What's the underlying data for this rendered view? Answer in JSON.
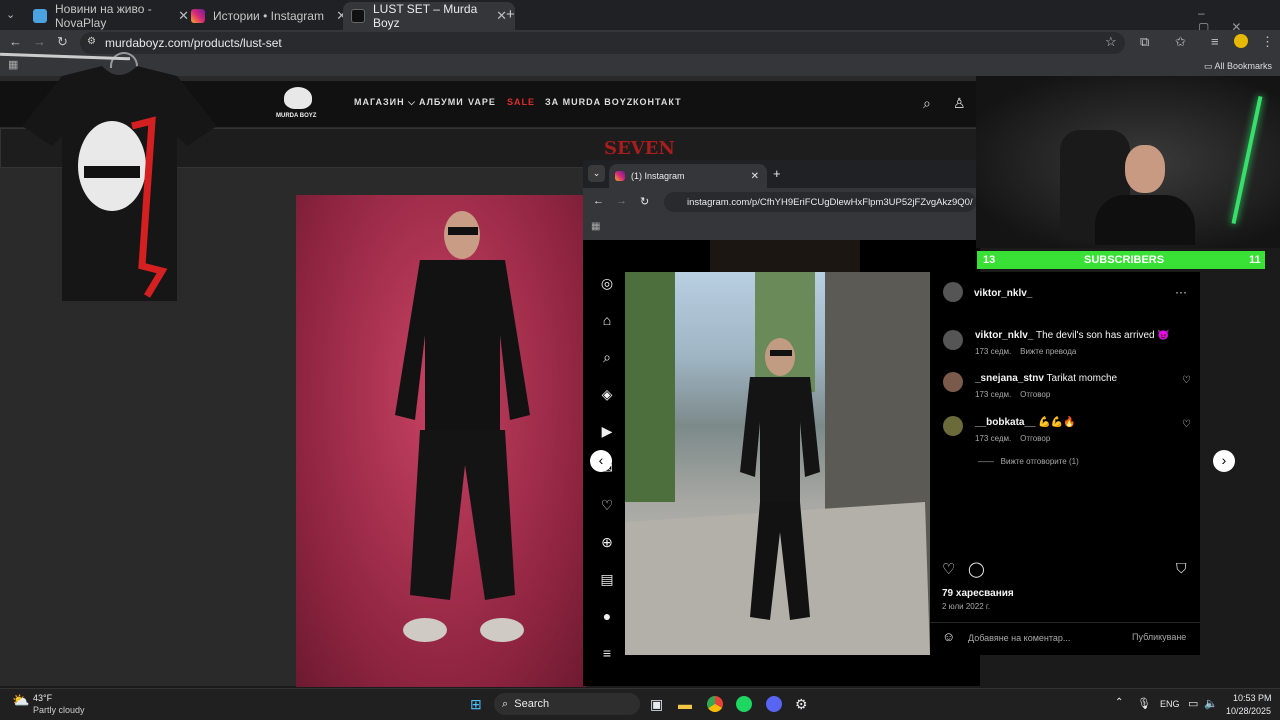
{
  "tabs": [
    {
      "label": "Новини на живо - NovaPlay",
      "color": "#4aa3df"
    },
    {
      "label": "Истории • Instagram",
      "color": "#d62976"
    },
    {
      "label": "LUST SET – Murda Boyz",
      "color": "#333333"
    }
  ],
  "url": "murdaboyz.com/products/lust-set",
  "bookmarks_label": "All Bookmarks",
  "site": {
    "logo": "MURDA BOYZ",
    "nav": [
      "МАГАЗИН",
      "АЛБУМИ",
      "VAPE",
      "SALE",
      "ЗА MURDA BOYZ",
      "КОНТАКТ"
    ],
    "nav_dropdown": "⌵",
    "banner": "SEVEN"
  },
  "popup": {
    "tab_label": "(1) Instagram",
    "url": "instagram.com/p/CfhYH9EriFCUgDlewHxFlpm3UP52jFZvgAkz9Q0/",
    "author": "viktor_nklv_",
    "caption_user": "viktor_nklv_",
    "caption_text": "The devil's son has arrived 😈",
    "caption_time": "173 седм.",
    "caption_action": "Вижте превода",
    "comments": [
      {
        "user": "_snejana_stnv",
        "text": "Tarikat momche",
        "time": "173 седм.",
        "action": "Отговор"
      },
      {
        "user": "__bobkata__",
        "text": "💪💪🔥",
        "time": "173 седм.",
        "action": "Отговор"
      }
    ],
    "view_replies": "Вижте отговорите (1)",
    "likes": "79 харесвания",
    "date": "2 юли 2022 г.",
    "comment_placeholder": "Добавяне на коментар...",
    "publish": "Публикуване"
  },
  "subbar": {
    "left": "13",
    "label": "SUBSCRIBERS",
    "right": "11"
  },
  "taskbar": {
    "weather_temp": "43°F",
    "weather_desc": "Partly cloudy",
    "search": "Search",
    "lang": "ENG",
    "time": "10:53 PM",
    "date": "10/28/2025"
  }
}
